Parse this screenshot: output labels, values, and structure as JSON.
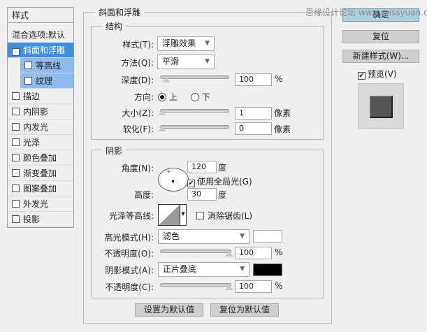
{
  "sidebar": {
    "header": "样式",
    "blend": "混合选项:默认",
    "items": [
      {
        "label": "斜面和浮雕",
        "checked": true
      },
      {
        "label": "等高线",
        "checked": false
      },
      {
        "label": "纹理",
        "checked": false
      },
      {
        "label": "描边",
        "checked": false
      },
      {
        "label": "内阴影",
        "checked": false
      },
      {
        "label": "内发光",
        "checked": false
      },
      {
        "label": "光泽",
        "checked": false
      },
      {
        "label": "颜色叠加",
        "checked": false
      },
      {
        "label": "渐变叠加",
        "checked": false
      },
      {
        "label": "图案叠加",
        "checked": false
      },
      {
        "label": "外发光",
        "checked": false
      },
      {
        "label": "投影",
        "checked": false
      }
    ]
  },
  "main": {
    "title": "斜面和浮雕",
    "structure": {
      "title": "结构",
      "style_label": "样式(T):",
      "style_value": "浮雕效果",
      "method_label": "方法(Q):",
      "method_value": "平滑",
      "depth_label": "深度(D):",
      "depth_value": "100",
      "depth_unit": "%",
      "direction_label": "方向:",
      "dir_up": "上",
      "dir_down": "下",
      "direction_selected": "上",
      "size_label": "大小(Z):",
      "size_value": "1",
      "size_unit": "像素",
      "soften_label": "软化(F):",
      "soften_value": "0",
      "soften_unit": "像素"
    },
    "shading": {
      "title": "阴影",
      "angle_label": "角度(N):",
      "angle_value": "120",
      "angle_unit": "度",
      "global_light": "使用全局光(G)",
      "global_light_checked": true,
      "altitude_label": "高度:",
      "altitude_value": "30",
      "altitude_unit": "度",
      "gloss_label": "光泽等高线:",
      "antialias": "消除锯齿(L)",
      "highlight_label": "高光模式(H):",
      "highlight_mode": "滤色",
      "highlight_color": "#ffffff",
      "hl_opacity_label": "不透明度(O):",
      "hl_opacity": "100",
      "hl_unit": "%",
      "shadow_label": "阴影模式(A):",
      "shadow_mode": "正片叠底",
      "shadow_color": "#000000",
      "sh_opacity_label": "不透明度(C):",
      "sh_opacity": "100",
      "sh_unit": "%"
    },
    "make_default": "设置为默认值",
    "reset_default": "复位为默认值"
  },
  "right": {
    "ok": "确定",
    "reset": "复位",
    "new_style": "新建样式(W)...",
    "preview": "预览(V)",
    "preview_checked": true
  },
  "watermark": "思缘设计论坛 www.missyuan.com"
}
